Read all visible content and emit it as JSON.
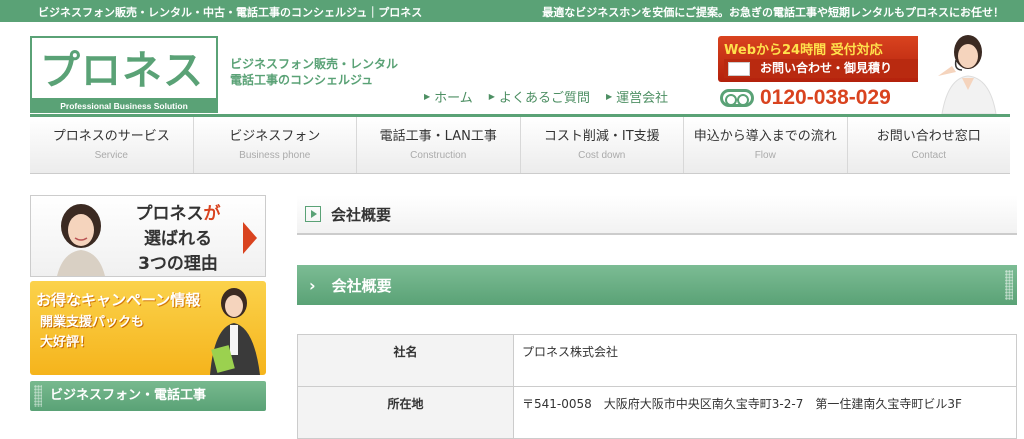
{
  "topbar": {
    "left": "ビジネスフォン販売・レンタル・中古・電話工事のコンシェルジュ｜プロネス",
    "right": "最適なビジネスホンを安価にご提案。お急ぎの電話工事や短期レンタルもプロネスにお任せ！"
  },
  "logo": {
    "kana": "プロネス",
    "eng": "Professional  Business Solution"
  },
  "tagline": {
    "line1": "ビジネスフォン販売・レンタル",
    "line2": "電話工事のコンシェルジュ"
  },
  "header_nav": [
    "ホーム",
    "よくあるご質問",
    "運営会社"
  ],
  "cta": {
    "line1": "Webから24時間 受付対応",
    "line2": "お問い合わせ・御見積り"
  },
  "phone": {
    "number": "0120-038-029"
  },
  "nav": [
    {
      "ja": "プロネスのサービス",
      "en": "Service"
    },
    {
      "ja": "ビジネスフォン",
      "en": "Business phone"
    },
    {
      "ja": "電話工事・LAN工事",
      "en": "Construction"
    },
    {
      "ja": "コスト削減・IT支援",
      "en": "Cost down"
    },
    {
      "ja": "申込から導入までの流れ",
      "en": "Flow"
    },
    {
      "ja": "お問い合わせ窓口",
      "en": "Contact"
    }
  ],
  "sidebar": {
    "banner1": {
      "line1a": "プロネス",
      "line1b": "が",
      "line2": "選ばれる",
      "line3": "3つの理由"
    },
    "banner2": {
      "head": "お得なキャンペーン情報",
      "line1": "開業支援パックも",
      "line2": "大好評！"
    },
    "section": "ビジネスフォン・電話工事"
  },
  "main": {
    "page_title": "会社概要",
    "section_title": "会社概要",
    "rows": [
      {
        "key": "社名",
        "value": "プロネス株式会社"
      },
      {
        "key": "所在地",
        "value": "〒541-0058　大阪府大阪市中央区南久宝寺町3-2-7　第一住建南久宝寺町ビル3F"
      }
    ]
  },
  "colors": {
    "green": "#5aa276",
    "red": "#d9431f",
    "yellow": "#f5b41c"
  }
}
